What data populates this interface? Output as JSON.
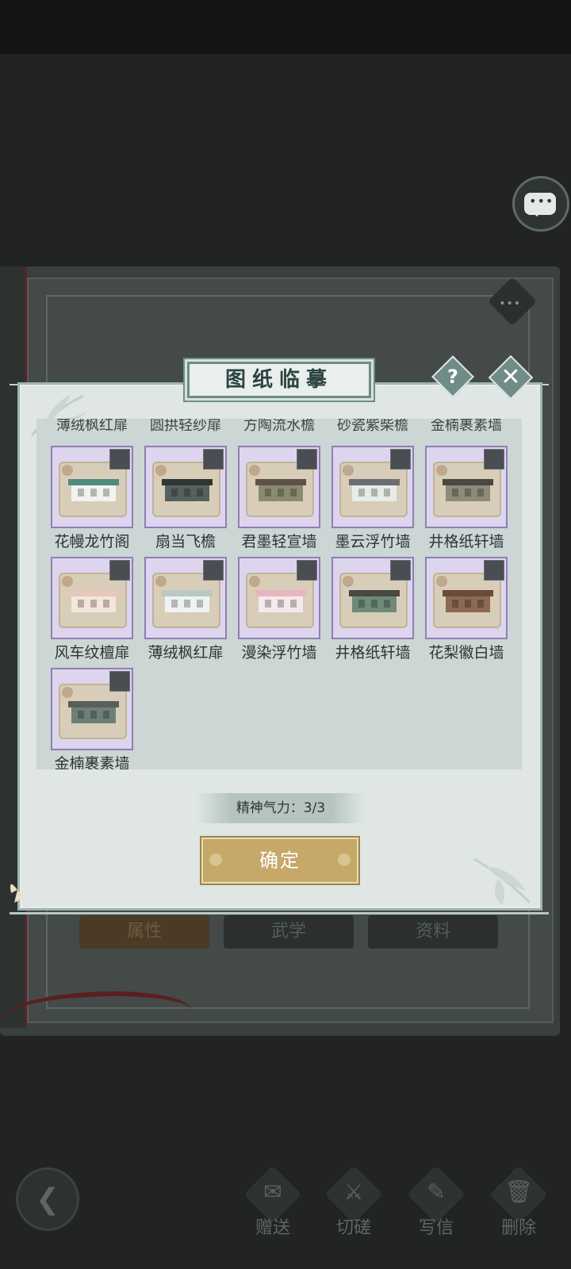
{
  "dialog": {
    "title": "图纸临摹",
    "help_icon": "?",
    "close_icon": "✕"
  },
  "cut_off_row": [
    "薄绒枫红扉",
    "圆拱轻纱扉",
    "方陶流水檐",
    "砂瓷紫柴檐",
    "金楠裹素墙"
  ],
  "blueprints": [
    {
      "name": "花幔龙竹阁",
      "roof": "#4e8c7c",
      "wall": "#f2f2ee"
    },
    {
      "name": "扇当飞檐",
      "roof": "#2f3634",
      "wall": "#56605d"
    },
    {
      "name": "君墨轻宣墙",
      "roof": "#5c5248",
      "wall": "#8a8b6e"
    },
    {
      "name": "墨云浮竹墙",
      "roof": "#6a6e70",
      "wall": "#e8ece9"
    },
    {
      "name": "井格纸轩墙",
      "roof": "#4a4842",
      "wall": "#8e8a78"
    },
    {
      "name": "风车纹檀扉",
      "roof": "#e6c8bc",
      "wall": "#f4e6dc"
    },
    {
      "name": "薄绒枫红扉",
      "roof": "#b9c8c4",
      "wall": "#eef3f1"
    },
    {
      "name": "漫染浮竹墙",
      "roof": "#e8b6c0",
      "wall": "#f6e8ec"
    },
    {
      "name": "井格纸轩墙",
      "roof": "#4a4842",
      "wall": "#6f8a78"
    },
    {
      "name": "花梨徽白墙",
      "roof": "#6a4a38",
      "wall": "#8a6a52"
    },
    {
      "name": "金楠裹素墙",
      "roof": "#5a5e5a",
      "wall": "#6c8078"
    }
  ],
  "stamina": {
    "text": "精神气力：3/3"
  },
  "confirm_label": "确定",
  "background": {
    "tabs": [
      "属性",
      "武学",
      "资料"
    ],
    "chat_dots": "•••",
    "badge_dots": "•••"
  },
  "bottom_actions": [
    {
      "label": "赠送",
      "icon": "scroll-icon",
      "glyph": "✉"
    },
    {
      "label": "切磋",
      "icon": "sword-icon",
      "glyph": "⚔"
    },
    {
      "label": "写信",
      "icon": "letter-icon",
      "glyph": "✎"
    },
    {
      "label": "删除",
      "icon": "trash-icon",
      "glyph": "🗑"
    }
  ],
  "back_glyph": "❮",
  "colors": {
    "accent_teal": "#6f8c88",
    "confirm_gold": "#c6a868",
    "card_border": "#8f7eb4"
  }
}
